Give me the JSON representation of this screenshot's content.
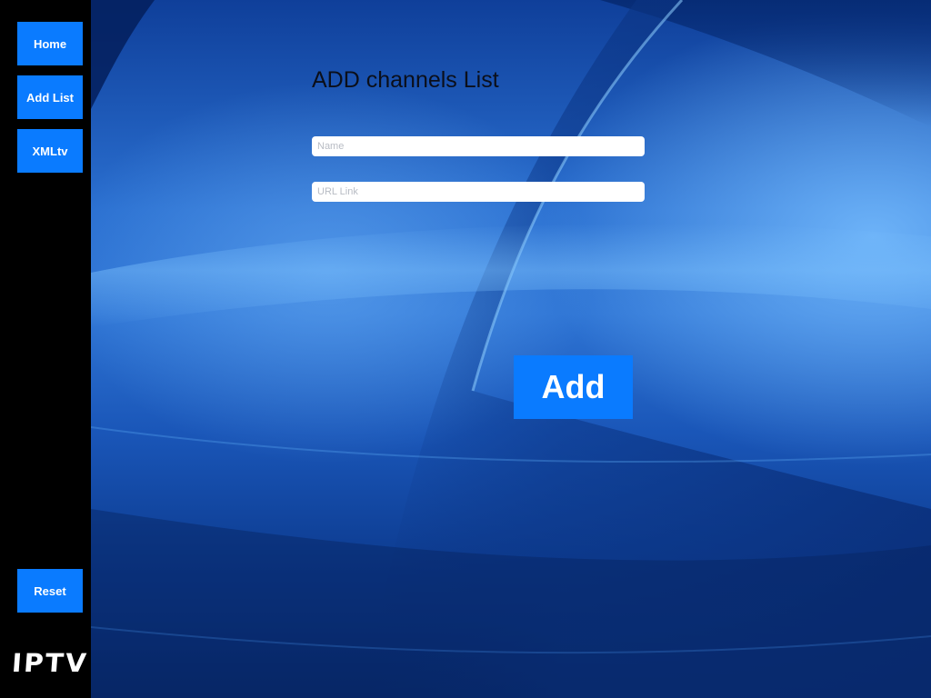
{
  "sidebar": {
    "home_label": "Home",
    "add_list_label": "Add List",
    "xmltv_label": "XMLtv",
    "reset_label": "Reset",
    "logo_text": "IPTV"
  },
  "form": {
    "title": "ADD channels List",
    "name_field": {
      "value": "",
      "placeholder": "Name"
    },
    "url_field": {
      "value": "",
      "placeholder": "URL Link"
    },
    "add_label": "Add"
  },
  "colors": {
    "sidebar_background": "#000000",
    "button_blue": "#0a7bff",
    "button_text": "#ffffff",
    "title_text": "#0b0f1a",
    "background_blue": "#1a56b8"
  }
}
